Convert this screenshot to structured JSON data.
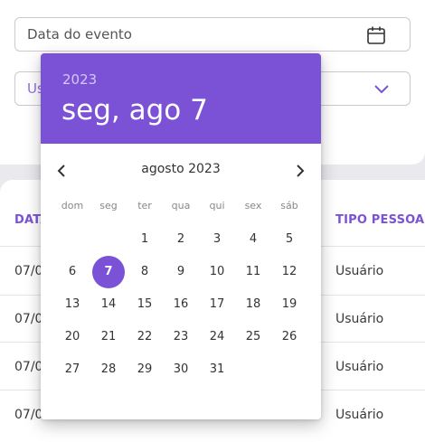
{
  "form": {
    "date_placeholder": "Data do evento",
    "user_select_value": "Us"
  },
  "table": {
    "headers": {
      "data": "DATA",
      "tipo": "TIPO PESSOA"
    },
    "rows": [
      {
        "date": "07/0",
        "tipo": "Usuário"
      },
      {
        "date": "07/0",
        "tipo": "Usuário"
      },
      {
        "date": "07/0",
        "tipo": "Usuário"
      },
      {
        "date": "07/0",
        "tipo": "Usuário"
      }
    ]
  },
  "picker": {
    "year": "2023",
    "selected_label": "seg, ago 7",
    "month_label": "agosto 2023",
    "weekdays": [
      "dom",
      "seg",
      "ter",
      "qua",
      "qui",
      "sex",
      "sáb"
    ],
    "days": [
      [
        "",
        "",
        "1",
        "2",
        "3",
        "4",
        "5"
      ],
      [
        "6",
        "7",
        "8",
        "9",
        "10",
        "11",
        "12"
      ],
      [
        "13",
        "14",
        "15",
        "16",
        "17",
        "18",
        "19"
      ],
      [
        "20",
        "21",
        "22",
        "23",
        "24",
        "25",
        "26"
      ],
      [
        "27",
        "28",
        "29",
        "30",
        "31",
        "",
        ""
      ]
    ],
    "selected_day": "7"
  },
  "colors": {
    "accent": "#7b52d6",
    "header_bg": "#7b52d6"
  },
  "icons": {
    "date_field": "calendar-icon",
    "select": "chevron-down-icon",
    "prev": "chevron-left-icon",
    "next": "chevron-right-icon"
  }
}
